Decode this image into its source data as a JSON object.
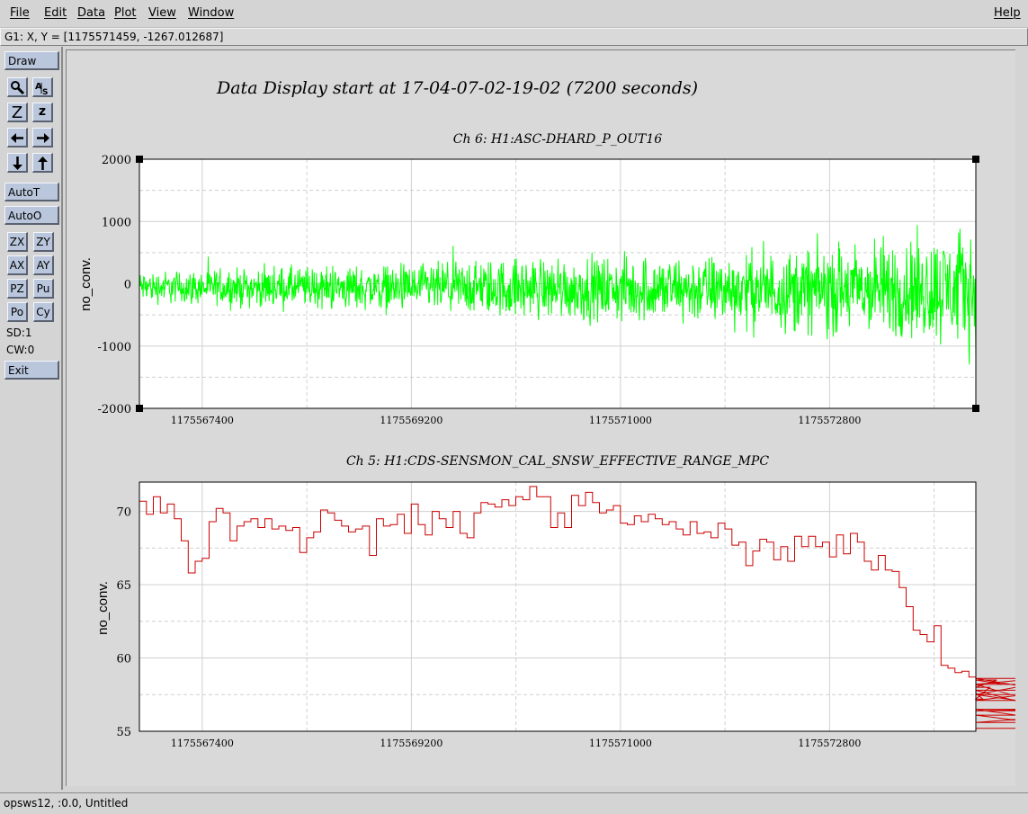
{
  "menubar": {
    "items": [
      "File",
      "Edit",
      "Data",
      "Plot",
      "View",
      "Window"
    ],
    "help": "Help"
  },
  "coord_readout": "G1: X, Y = [1175571459, -1267.012687]",
  "toolbar": {
    "draw": "Draw",
    "zoom_big": "Z",
    "zoom_small": "z",
    "autot": "AutoT",
    "autoo": "AutoO",
    "zx": "ZX",
    "zy": "ZY",
    "ax": "AX",
    "ay": "AY",
    "pz": "PZ",
    "pu": "Pu",
    "po": "Po",
    "cy": "Cy",
    "sd": "SD:1",
    "cw": "CW:0",
    "exit": "Exit"
  },
  "canvas_title": "Data Display start at 17-04-07-02-19-02 (7200 seconds)",
  "status": "opsws12, :0.0, Untitled",
  "chart_data": [
    {
      "type": "line",
      "title": "Ch 6: H1:ASC-DHARD_P_OUT16",
      "ylabel": "no_conv.",
      "xlabel": "",
      "xlim": [
        1175566859,
        1175574059
      ],
      "ylim": [
        -2000,
        2000
      ],
      "x_ticks": [
        "1175567400",
        "1175569200",
        "1175571000",
        "1175572800"
      ],
      "x_tick_values": [
        1175567400,
        1175569200,
        1175571000,
        1175572800
      ],
      "y_ticks": [
        "2000",
        "1000",
        "0",
        "-1000",
        "-2000"
      ],
      "y_tick_values": [
        2000,
        1000,
        0,
        -1000,
        -2000
      ],
      "color": "#00ff00",
      "series": [
        {
          "envelope_x": [
            1175566859,
            1175567400,
            1175568300,
            1175569200,
            1175570100,
            1175571000,
            1175571900,
            1175572800,
            1175573400,
            1175574059
          ],
          "upper": [
            280,
            300,
            380,
            420,
            560,
            580,
            640,
            820,
            980,
            1150
          ],
          "lower": [
            -380,
            -420,
            -500,
            -560,
            -700,
            -760,
            -820,
            -1020,
            -1150,
            -1300
          ]
        }
      ]
    },
    {
      "type": "line",
      "title": "Ch 5: H1:CDS-SENSMON_CAL_SNSW_EFFECTIVE_RANGE_MPC",
      "ylabel": "no_conv.",
      "xlabel": "",
      "xlim": [
        1175566859,
        1175574059
      ],
      "ylim": [
        55,
        72
      ],
      "x_ticks": [
        "1175567400",
        "1175569200",
        "1175571000",
        "1175572800"
      ],
      "x_tick_values": [
        1175567400,
        1175569200,
        1175571000,
        1175572800
      ],
      "y_ticks": [
        "70",
        "65",
        "60",
        "55"
      ],
      "y_tick_values": [
        70,
        65,
        60,
        55
      ],
      "color": "#cc0000",
      "series": [
        {
          "step": 60,
          "values": [
            70.7,
            69.8,
            71.0,
            69.9,
            70.5,
            69.5,
            68.0,
            65.8,
            66.6,
            66.8,
            69.3,
            70.2,
            69.9,
            68.0,
            69.0,
            69.3,
            69.5,
            68.9,
            69.5,
            68.8,
            69.0,
            68.7,
            68.9,
            67.2,
            68.2,
            68.6,
            70.1,
            69.9,
            69.4,
            69.0,
            68.6,
            68.8,
            69.0,
            67.0,
            69.5,
            69.0,
            69.1,
            69.8,
            68.5,
            70.5,
            69.1,
            68.4,
            70.0,
            69.5,
            68.9,
            70.0,
            68.5,
            68.2,
            69.9,
            70.6,
            70.5,
            70.3,
            70.8,
            70.4,
            71.0,
            70.8,
            71.7,
            71.0,
            71.0,
            68.9,
            69.9,
            68.9,
            71.1,
            70.4,
            71.3,
            70.6,
            69.9,
            70.1,
            70.4,
            69.2,
            69.1,
            69.7,
            69.3,
            69.8,
            69.5,
            69.1,
            69.3,
            68.8,
            68.4,
            69.3,
            68.5,
            68.6,
            68.2,
            69.2,
            68.8,
            67.7,
            67.9,
            66.3,
            67.3,
            68.1,
            67.9,
            66.7,
            67.6,
            66.6,
            68.3,
            67.6,
            68.3,
            67.6,
            67.9,
            66.9,
            68.4,
            67.1,
            68.5,
            67.9,
            66.6,
            66.0,
            67.0,
            66.0,
            65.9,
            64.8,
            63.5,
            61.9,
            61.6,
            61.1,
            62.2,
            59.5,
            59.3,
            59.0,
            59.1,
            58.7,
            57.6,
            57.2,
            58.0,
            58.5,
            58.2,
            57.5,
            57.1,
            57.5,
            58.2,
            58.6,
            57.8,
            56.4,
            56.5,
            55.6,
            56.1,
            55.2
          ]
        }
      ]
    }
  ]
}
